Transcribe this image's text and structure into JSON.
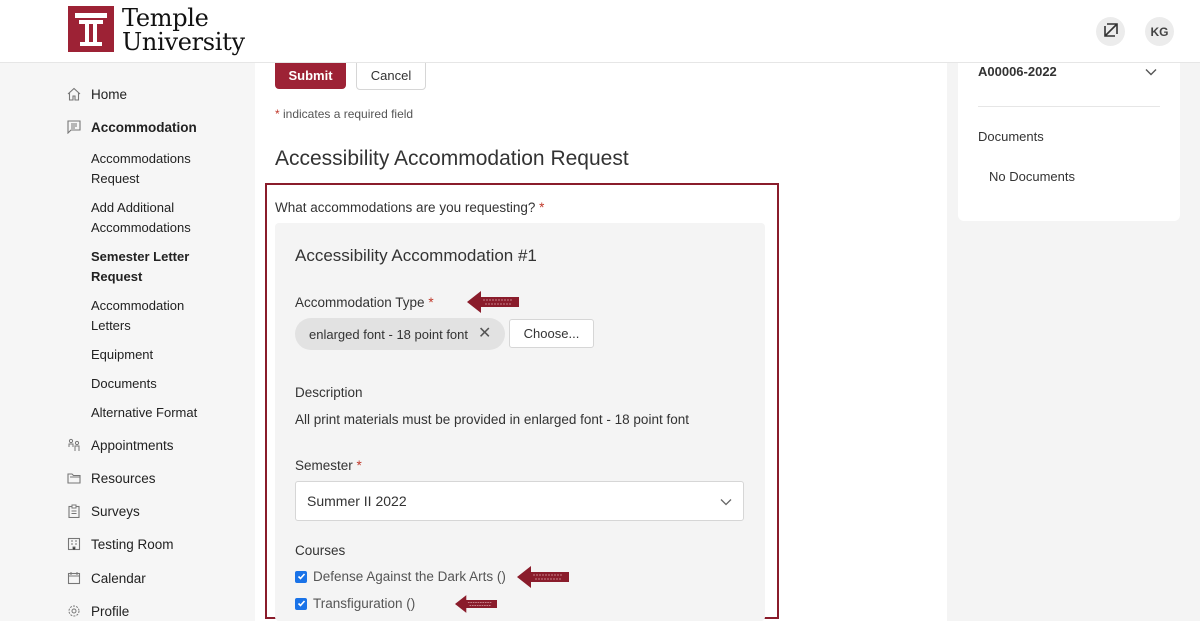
{
  "header": {
    "logo_line1": "Temple",
    "logo_line2": "University",
    "expand_icon": "expand-arrows-icon",
    "avatar_initials": "KG"
  },
  "sidebar": {
    "items": [
      {
        "label": "Home",
        "icon": "home-icon"
      },
      {
        "label": "Accommodation",
        "icon": "list-chat-icon",
        "active": true
      },
      {
        "label": "Appointments",
        "icon": "people-icon"
      },
      {
        "label": "Resources",
        "icon": "folder-icon"
      },
      {
        "label": "Surveys",
        "icon": "clipboard-icon"
      },
      {
        "label": "Testing Room",
        "icon": "building-icon"
      },
      {
        "label": "Calendar",
        "icon": "calendar-icon"
      },
      {
        "label": "Profile",
        "icon": "gear-icon"
      }
    ],
    "subitems": [
      {
        "label": "Accommodations Request"
      },
      {
        "label": "Add Additional Accommodations"
      },
      {
        "label": "Semester Letter Request",
        "active": true
      },
      {
        "label": "Accommodation Letters"
      },
      {
        "label": "Equipment"
      },
      {
        "label": "Documents"
      },
      {
        "label": "Alternative Format"
      }
    ]
  },
  "main": {
    "submit_label": "Submit",
    "cancel_label": "Cancel",
    "required_star": "*",
    "required_note": " indicates a required field",
    "page_title": "Accessibility Accommodation Request",
    "question": "What accommodations are you requesting?",
    "card": {
      "title": "Accessibility Accommodation #1",
      "type_label": "Accommodation Type",
      "type_chip": "enlarged font - 18 point font",
      "choose_label": "Choose...",
      "description_label": "Description",
      "description_text": "All print materials must be provided in enlarged font - 18 point font",
      "semester_label": "Semester",
      "semester_value": "Summer II 2022",
      "courses_label": "Courses",
      "courses": [
        {
          "label": "Defense Against the Dark Arts ()",
          "checked": true
        },
        {
          "label": "Transfiguration ()",
          "checked": true
        }
      ]
    }
  },
  "right_panel": {
    "request_id": "A00006-2022",
    "documents_label": "Documents",
    "no_documents": "No Documents"
  },
  "colors": {
    "brand": "#9d2235",
    "annotation_arrow": "#8a1c2b",
    "checkbox": "#1a73e8"
  }
}
